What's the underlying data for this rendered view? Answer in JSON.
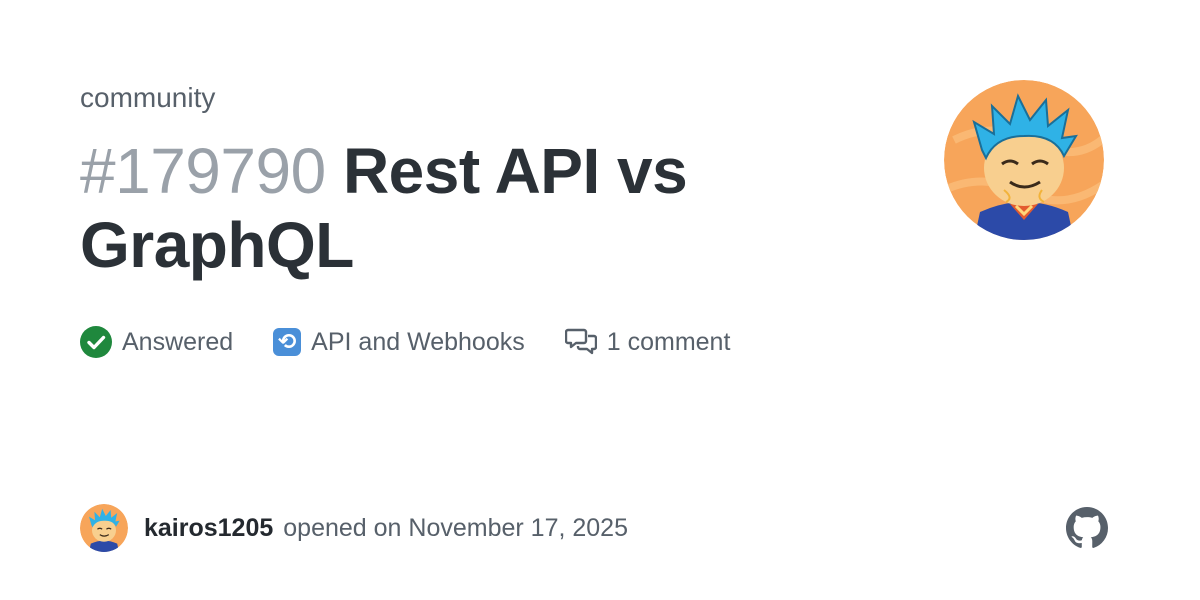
{
  "header": {
    "repo": "community",
    "issue_number": "#179790",
    "title": "Rest API vs GraphQL"
  },
  "meta": {
    "status": {
      "label": "Answered",
      "icon": "check-circle-icon",
      "color": "#1f883d"
    },
    "category": {
      "label": "API and Webhooks",
      "icon": "arrows-counterclockwise-emoji-icon"
    },
    "comments": {
      "label": "1 comment",
      "icon": "comment-discussion-icon"
    }
  },
  "footer": {
    "author": "kairos1205",
    "opened_text": "opened on November 17, 2025"
  },
  "colors": {
    "title": "#2b3137",
    "number": "#9aa1a9",
    "muted": "#57606a",
    "avatar_bg": "#f7a55a",
    "hair": "#2fb2e6",
    "shirt": "#2c4aa8"
  }
}
